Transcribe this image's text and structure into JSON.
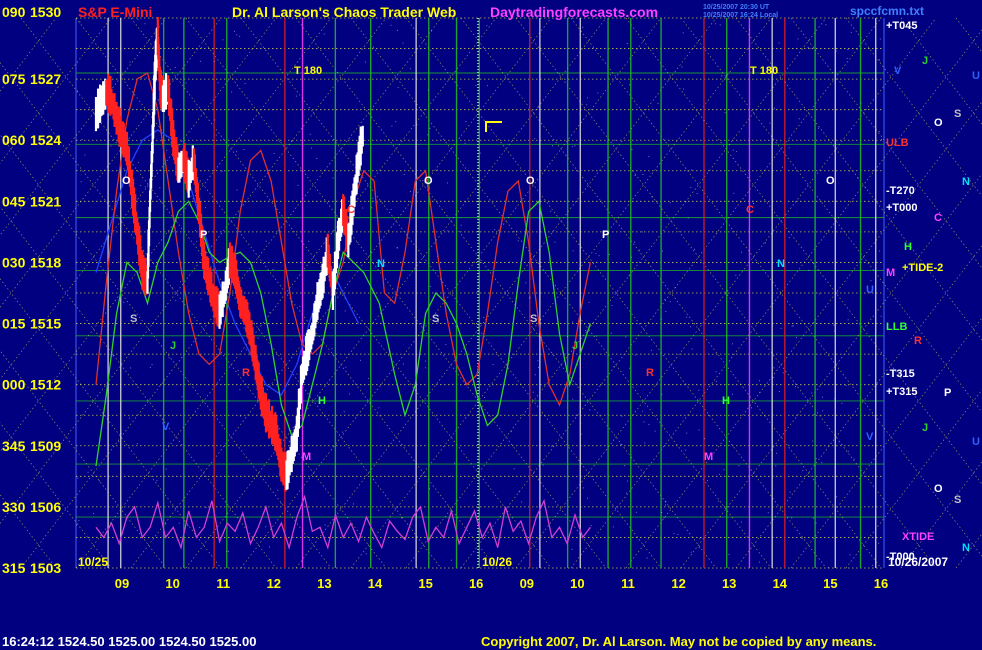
{
  "header": {
    "instrument": "S&P E-Mini",
    "title": "Dr. Al Larson's Chaos Trader Web",
    "site": "Daytradingforecasts.com",
    "date_lines": [
      "10/25/2007 20:30 UT",
      "10/25/2007 16:24 Local"
    ],
    "chart_file": "spccfcmn.txt"
  },
  "status": {
    "quote": "16:24:12  1524.50 1525.00 1524.50 1525.00",
    "copyright": "Copyright 2007, Dr. Al Larson. May not be copied by any means."
  },
  "colors": {
    "background": "#000080",
    "header_instrument": "#ff2020",
    "header_title": "#ffff00",
    "header_site": "#ff40ff",
    "header_date": "#4080ff",
    "tick_labels": "#ffff00",
    "time_labels": "#ffff00",
    "price_bars_up": "#ffffff",
    "price_bars_down": "#ff2020",
    "grid_dotted": "#ffff40",
    "grid_green": "#20c020",
    "grid_white": "#e0e0e0",
    "grid_red": "#e02020",
    "grid_magenta": "#ff40ff",
    "green_line": "#30d030",
    "red_line": "#e03030",
    "blue_line": "#2040ff",
    "magenta_xtide": "#d040d0"
  },
  "chart_data": {
    "type": "line",
    "series_style": "price bars with overlay cycle lines",
    "y_tick_labels": [
      {
        "angle": "090",
        "price": "1530"
      },
      {
        "angle": "075",
        "price": "1527"
      },
      {
        "angle": "060",
        "price": "1524"
      },
      {
        "angle": "045",
        "price": "1521"
      },
      {
        "angle": "030",
        "price": "1518"
      },
      {
        "angle": "015",
        "price": "1515"
      },
      {
        "angle": "000",
        "price": "1512"
      },
      {
        "angle": "345",
        "price": "1509"
      },
      {
        "angle": "330",
        "price": "1506"
      },
      {
        "angle": "315",
        "price": "1503"
      }
    ],
    "ylim": [
      1503,
      1530
    ],
    "x_tick_labels": [
      "09",
      "10",
      "11",
      "12",
      "13",
      "14",
      "15",
      "16",
      "09",
      "10",
      "11",
      "12",
      "13",
      "14",
      "15",
      "16"
    ],
    "date_labels": [
      "10/25",
      "10/26",
      "10/26/2007"
    ],
    "right_labels": [
      {
        "text": "+T045",
        "color": "#ffffff"
      },
      {
        "text": "ULB",
        "color": "#ff3030"
      },
      {
        "text": "-T270",
        "color": "#ffffff"
      },
      {
        "text": "+T000",
        "color": "#ffffff"
      },
      {
        "text": "+TIDE-2",
        "color": "#ffff00"
      },
      {
        "text": "LLB",
        "color": "#30ff30"
      },
      {
        "text": "-T315",
        "color": "#ffffff"
      },
      {
        "text": "+T315",
        "color": "#ffffff"
      },
      {
        "text": "XTIDE",
        "color": "#ff40ff"
      },
      {
        "text": "-T000",
        "color": "#ffffff"
      }
    ],
    "planet_legend": [
      {
        "text": "J",
        "color": "#30d030"
      },
      {
        "text": "U",
        "color": "#3060ff"
      },
      {
        "text": "V",
        "color": "#3060ff"
      },
      {
        "text": "O",
        "color": "#ffffff"
      },
      {
        "text": "S",
        "color": "#c0c0c0"
      },
      {
        "text": "N",
        "color": "#00e0ff"
      },
      {
        "text": "C",
        "color": "#ff40ff"
      },
      {
        "text": "H",
        "color": "#30ff30"
      },
      {
        "text": "M",
        "color": "#ff40ff"
      },
      {
        "text": "R",
        "color": "#ff3030"
      },
      {
        "text": "P",
        "color": "#ffffff"
      },
      {
        "text": "J",
        "color": "#30d030"
      },
      {
        "text": "U",
        "color": "#3060ff"
      },
      {
        "text": "O",
        "color": "#ffffff"
      },
      {
        "text": "S",
        "color": "#c0c0c0"
      },
      {
        "text": "N",
        "color": "#00e0ff"
      }
    ],
    "in_chart_letters": [
      {
        "text": "T 180",
        "color": "#ffff00"
      },
      {
        "text": "T 180",
        "color": "#ffff00"
      },
      {
        "text": "O",
        "color": "#ffffff"
      },
      {
        "text": "O",
        "color": "#ffffff"
      },
      {
        "text": "O",
        "color": "#ffffff"
      },
      {
        "text": "O",
        "color": "#ffffff"
      },
      {
        "text": "P",
        "color": "#ffffff"
      },
      {
        "text": "P",
        "color": "#ffffff"
      },
      {
        "text": "C",
        "color": "#ff3030"
      },
      {
        "text": "C",
        "color": "#ff3030"
      },
      {
        "text": "N",
        "color": "#00e0ff"
      },
      {
        "text": "N",
        "color": "#00e0ff"
      },
      {
        "text": "S",
        "color": "#c0c0c0"
      },
      {
        "text": "S",
        "color": "#c0c0c0"
      },
      {
        "text": "S",
        "color": "#c0c0c0"
      },
      {
        "text": "J",
        "color": "#30d030"
      },
      {
        "text": "J",
        "color": "#30d030"
      },
      {
        "text": "R",
        "color": "#ff3030"
      },
      {
        "text": "R",
        "color": "#ff3030"
      },
      {
        "text": "H",
        "color": "#30ff30"
      },
      {
        "text": "H",
        "color": "#30ff30"
      },
      {
        "text": "M",
        "color": "#ff40ff"
      },
      {
        "text": "M",
        "color": "#ff40ff"
      },
      {
        "text": "V",
        "color": "#3060ff"
      },
      {
        "text": "V",
        "color": "#3060ff"
      },
      {
        "text": "U",
        "color": "#3060ff"
      }
    ],
    "price_path": [
      [
        0.0,
        1525.2
      ],
      [
        0.1,
        1525.8
      ],
      [
        0.2,
        1526.3
      ],
      [
        0.3,
        1526.0
      ],
      [
        0.4,
        1525.0
      ],
      [
        0.5,
        1524.2
      ],
      [
        0.6,
        1523.5
      ],
      [
        0.7,
        1521.5
      ],
      [
        0.8,
        1519.5
      ],
      [
        0.9,
        1517.5
      ],
      [
        1.0,
        1517.0
      ],
      [
        1.05,
        1521.0
      ],
      [
        1.1,
        1524.0
      ],
      [
        1.15,
        1527.5
      ],
      [
        1.2,
        1529.0
      ],
      [
        1.25,
        1526.5
      ],
      [
        1.3,
        1526.0
      ],
      [
        1.4,
        1526.5
      ],
      [
        1.5,
        1524.0
      ],
      [
        1.6,
        1522.5
      ],
      [
        1.7,
        1523.0
      ],
      [
        1.8,
        1522.0
      ],
      [
        1.9,
        1523.0
      ],
      [
        2.0,
        1520.5
      ],
      [
        2.1,
        1518.0
      ],
      [
        2.2,
        1517.0
      ],
      [
        2.3,
        1516.0
      ],
      [
        2.4,
        1515.5
      ],
      [
        2.5,
        1516.5
      ],
      [
        2.6,
        1518.0
      ],
      [
        2.7,
        1517.5
      ],
      [
        2.8,
        1516.0
      ],
      [
        2.9,
        1515.5
      ],
      [
        3.0,
        1514.5
      ],
      [
        3.1,
        1513.0
      ],
      [
        3.2,
        1511.5
      ],
      [
        3.3,
        1510.5
      ],
      [
        3.4,
        1510.0
      ],
      [
        3.5,
        1509.5
      ],
      [
        3.6,
        1508.0
      ],
      [
        3.7,
        1507.5
      ],
      [
        3.8,
        1508.5
      ],
      [
        3.9,
        1509.5
      ],
      [
        4.0,
        1512.5
      ],
      [
        4.1,
        1513.5
      ],
      [
        4.2,
        1514.5
      ],
      [
        4.3,
        1516.0
      ],
      [
        4.4,
        1517.0
      ],
      [
        4.5,
        1518.5
      ],
      [
        4.6,
        1516.5
      ],
      [
        4.7,
        1519.0
      ],
      [
        4.8,
        1520.5
      ],
      [
        4.9,
        1519.0
      ],
      [
        5.0,
        1521.0
      ],
      [
        5.1,
        1523.0
      ],
      [
        5.2,
        1524.5
      ]
    ],
    "green_path": [
      [
        0.0,
        1508.0
      ],
      [
        0.2,
        1511.5
      ],
      [
        0.4,
        1515.5
      ],
      [
        0.6,
        1518.0
      ],
      [
        0.8,
        1517.5
      ],
      [
        1.0,
        1516.0
      ],
      [
        1.2,
        1518.0
      ],
      [
        1.4,
        1519.0
      ],
      [
        1.6,
        1520.5
      ],
      [
        1.8,
        1521.0
      ],
      [
        2.0,
        1520.0
      ],
      [
        2.2,
        1518.5
      ],
      [
        2.4,
        1518.0
      ],
      [
        2.6,
        1518.3
      ],
      [
        2.8,
        1518.5
      ],
      [
        3.0,
        1518.0
      ],
      [
        3.2,
        1516.5
      ],
      [
        3.4,
        1514.0
      ],
      [
        3.6,
        1511.0
      ],
      [
        3.8,
        1509.5
      ],
      [
        4.0,
        1510.0
      ],
      [
        4.2,
        1512.0
      ],
      [
        4.4,
        1514.0
      ],
      [
        4.6,
        1516.5
      ],
      [
        4.8,
        1518.5
      ],
      [
        5.0,
        1518.0
      ],
      [
        5.2,
        1517.5
      ],
      [
        5.5,
        1516.0
      ],
      [
        5.8,
        1512.5
      ],
      [
        6.0,
        1510.5
      ],
      [
        6.2,
        1512.0
      ],
      [
        6.4,
        1515.5
      ],
      [
        6.6,
        1516.5
      ],
      [
        6.8,
        1516.0
      ],
      [
        7.0,
        1515.0
      ],
      [
        7.2,
        1513.5
      ],
      [
        7.4,
        1511.5
      ],
      [
        7.6,
        1510.0
      ],
      [
        7.8,
        1510.5
      ],
      [
        8.0,
        1513.0
      ],
      [
        8.2,
        1517.0
      ],
      [
        8.4,
        1520.5
      ],
      [
        8.6,
        1521.0
      ],
      [
        8.8,
        1518.5
      ],
      [
        9.0,
        1514.5
      ],
      [
        9.2,
        1512.0
      ],
      [
        9.4,
        1513.5
      ],
      [
        9.6,
        1515.0
      ]
    ],
    "red_path": [
      [
        0.0,
        1512.0
      ],
      [
        0.2,
        1517.0
      ],
      [
        0.4,
        1521.5
      ],
      [
        0.6,
        1525.0
      ],
      [
        0.8,
        1527.0
      ],
      [
        1.0,
        1527.3
      ],
      [
        1.2,
        1525.5
      ],
      [
        1.4,
        1522.0
      ],
      [
        1.6,
        1518.5
      ],
      [
        1.8,
        1515.5
      ],
      [
        2.0,
        1513.5
      ],
      [
        2.2,
        1513.0
      ],
      [
        2.4,
        1513.5
      ],
      [
        2.6,
        1516.5
      ],
      [
        2.8,
        1520.5
      ],
      [
        3.0,
        1523.0
      ],
      [
        3.2,
        1523.5
      ],
      [
        3.4,
        1522.0
      ],
      [
        3.6,
        1519.0
      ],
      [
        3.8,
        1516.0
      ],
      [
        4.0,
        1514.0
      ],
      [
        4.2,
        1513.5
      ],
      [
        4.4,
        1514.0
      ],
      [
        4.6,
        1516.5
      ],
      [
        4.8,
        1518.0
      ],
      [
        5.0,
        1521.0
      ],
      [
        5.2,
        1522.5
      ],
      [
        5.4,
        1522.0
      ],
      [
        5.6,
        1516.5
      ],
      [
        5.8,
        1516.0
      ],
      [
        6.0,
        1518.5
      ],
      [
        6.2,
        1522.0
      ],
      [
        6.4,
        1522.5
      ],
      [
        6.6,
        1519.0
      ],
      [
        6.8,
        1515.5
      ],
      [
        7.0,
        1513.0
      ],
      [
        7.2,
        1512.0
      ],
      [
        7.4,
        1512.5
      ],
      [
        7.6,
        1515.5
      ],
      [
        7.8,
        1519.0
      ],
      [
        8.0,
        1521.5
      ],
      [
        8.2,
        1522.0
      ],
      [
        8.4,
        1519.0
      ],
      [
        8.6,
        1515.0
      ],
      [
        8.8,
        1512.0
      ],
      [
        9.0,
        1511.0
      ],
      [
        9.2,
        1512.5
      ],
      [
        9.4,
        1515.5
      ],
      [
        9.6,
        1518.0
      ]
    ],
    "blue_path": [
      [
        0.0,
        1517.5
      ],
      [
        0.3,
        1520.0
      ],
      [
        0.6,
        1522.5
      ],
      [
        0.9,
        1524.0
      ],
      [
        1.2,
        1524.5
      ],
      [
        1.5,
        1524.0
      ],
      [
        1.8,
        1522.0
      ],
      [
        2.1,
        1519.5
      ],
      [
        2.4,
        1517.0
      ],
      [
        2.7,
        1515.0
      ],
      [
        3.0,
        1513.5
      ],
      [
        3.3,
        1512.0
      ],
      [
        3.6,
        1511.5
      ],
      [
        3.9,
        1513.0
      ],
      [
        4.2,
        1515.5
      ],
      [
        4.5,
        1518.0
      ],
      [
        4.8,
        1516.5
      ],
      [
        5.1,
        1515.0
      ]
    ],
    "xtide_path": [
      [
        0.0,
        1505.0
      ],
      [
        0.15,
        1504.5
      ],
      [
        0.3,
        1505.2
      ],
      [
        0.45,
        1504.2
      ],
      [
        0.6,
        1505.5
      ],
      [
        0.75,
        1506.0
      ],
      [
        0.9,
        1504.5
      ],
      [
        1.05,
        1505.0
      ],
      [
        1.2,
        1506.2
      ],
      [
        1.35,
        1504.5
      ],
      [
        1.5,
        1505.0
      ],
      [
        1.65,
        1504.0
      ],
      [
        1.8,
        1505.8
      ],
      [
        1.95,
        1504.5
      ],
      [
        2.1,
        1505.0
      ],
      [
        2.25,
        1506.3
      ],
      [
        2.4,
        1504.3
      ],
      [
        2.55,
        1505.2
      ],
      [
        2.7,
        1504.8
      ],
      [
        2.85,
        1505.7
      ],
      [
        3.0,
        1504.2
      ],
      [
        3.15,
        1505.0
      ],
      [
        3.3,
        1506.0
      ],
      [
        3.45,
        1504.5
      ],
      [
        3.6,
        1505.2
      ],
      [
        3.75,
        1504.0
      ],
      [
        3.9,
        1505.5
      ],
      [
        4.05,
        1506.5
      ],
      [
        4.2,
        1504.8
      ],
      [
        4.35,
        1505.0
      ],
      [
        4.5,
        1504.0
      ],
      [
        4.65,
        1505.6
      ],
      [
        4.8,
        1504.5
      ],
      [
        4.95,
        1505.2
      ],
      [
        5.1,
        1504.3
      ],
      [
        5.25,
        1505.5
      ],
      [
        5.4,
        1504.7
      ],
      [
        5.55,
        1504.0
      ],
      [
        5.7,
        1505.3
      ],
      [
        5.85,
        1504.8
      ],
      [
        6.0,
        1504.4
      ],
      [
        6.15,
        1505.5
      ],
      [
        6.3,
        1506.0
      ],
      [
        6.45,
        1504.3
      ],
      [
        6.6,
        1505.0
      ],
      [
        6.75,
        1504.5
      ],
      [
        6.9,
        1505.8
      ],
      [
        7.05,
        1504.2
      ],
      [
        7.2,
        1505.0
      ],
      [
        7.35,
        1505.8
      ],
      [
        7.5,
        1504.5
      ],
      [
        7.65,
        1505.2
      ],
      [
        7.8,
        1504.0
      ],
      [
        7.95,
        1506.0
      ],
      [
        8.1,
        1504.8
      ],
      [
        8.25,
        1505.3
      ],
      [
        8.4,
        1504.2
      ],
      [
        8.55,
        1505.5
      ],
      [
        8.7,
        1506.3
      ],
      [
        8.85,
        1504.5
      ],
      [
        9.0,
        1505.0
      ],
      [
        9.15,
        1504.2
      ],
      [
        9.3,
        1505.6
      ],
      [
        9.45,
        1504.5
      ],
      [
        9.6,
        1505.0
      ]
    ]
  }
}
